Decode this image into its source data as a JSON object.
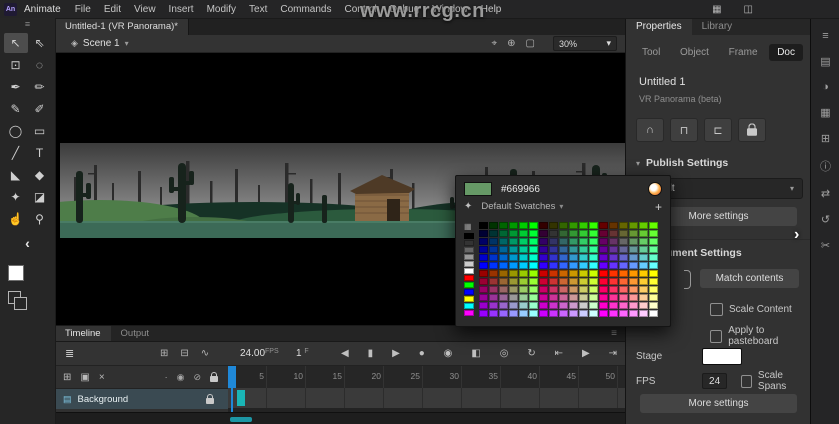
{
  "watermark": "www.rrcg.cn",
  "menubar": {
    "logo_text": "An",
    "app_name": "Animate",
    "items": [
      "File",
      "Edit",
      "View",
      "Insert",
      "Modify",
      "Text",
      "Commands",
      "Control",
      "Debug",
      "Window",
      "Help"
    ],
    "right_icons": [
      {
        "name": "workspace-icon",
        "glyph": "▦"
      },
      {
        "name": "panels-icon",
        "glyph": "◫"
      }
    ]
  },
  "toolbar": {
    "menu_icon": "≡",
    "tools": [
      {
        "name": "selection-tool",
        "glyph": "↖",
        "selected": true
      },
      {
        "name": "subselection-tool",
        "glyph": "⇖"
      },
      {
        "name": "free-transform-tool",
        "glyph": "⊡"
      },
      {
        "name": "lasso-tool",
        "glyph": "◌"
      },
      {
        "name": "pen-tool",
        "glyph": "✒"
      },
      {
        "name": "pencil-tool",
        "glyph": "✏"
      },
      {
        "name": "classic-brush-tool",
        "glyph": "✎"
      },
      {
        "name": "paint-brush-tool",
        "glyph": "✐"
      },
      {
        "name": "oval-tool",
        "glyph": "◯"
      },
      {
        "name": "rectangle-tool",
        "glyph": "▭"
      },
      {
        "name": "line-tool",
        "glyph": "╱"
      },
      {
        "name": "text-tool",
        "glyph": "T"
      },
      {
        "name": "paint-bucket-tool",
        "glyph": "◣"
      },
      {
        "name": "ink-bottle-tool",
        "glyph": "◆"
      },
      {
        "name": "eyedropper-tool",
        "glyph": "✦"
      },
      {
        "name": "eraser-tool",
        "glyph": "◪"
      },
      {
        "name": "hand-tool",
        "glyph": "☝"
      },
      {
        "name": "zoom-tool",
        "glyph": "⚲"
      }
    ],
    "collapse_icon": "‹"
  },
  "document_tab": {
    "title": "Untitled-1 (VR Panorama)*"
  },
  "edit_bar": {
    "scene_icon": "◈",
    "scene_label": "Scene 1",
    "scene_chevron": "▾",
    "icons": [
      {
        "name": "center-frame-icon",
        "glyph": "⌖"
      },
      {
        "name": "zoom-fit-icon",
        "glyph": "⊕"
      },
      {
        "name": "clip-content-icon",
        "glyph": "▢"
      }
    ],
    "zoom_value": "30%",
    "zoom_chevron": "▾"
  },
  "color_picker": {
    "hex": "#669966",
    "swatch_color": "#669966",
    "eyedropper_icon": "✦",
    "dropdown_label": "Default Swatches",
    "dropdown_chevron": "▾",
    "add_label": "+",
    "grid_icon": "▦",
    "palette": {
      "steps": [
        "00",
        "33",
        "66",
        "99",
        "CC",
        "FF"
      ],
      "left_column": [
        "#000000",
        "#333333",
        "#666666",
        "#999999",
        "#CCCCCC",
        "#FFFFFF",
        "#FF0000",
        "#00FF00",
        "#0000FF",
        "#FFFF00",
        "#00FFFF",
        "#FF00FF"
      ],
      "rows": 12,
      "cols": 18
    }
  },
  "properties": {
    "tabs": [
      {
        "label": "Properties",
        "active": true
      },
      {
        "label": "Library"
      }
    ],
    "subtabs": [
      {
        "label": "Tool"
      },
      {
        "label": "Object"
      },
      {
        "label": "Frame"
      },
      {
        "label": "Doc",
        "active": true
      }
    ],
    "doc_name": "Untitled 1",
    "doc_subtitle": "VR Panorama (beta)",
    "toggle_icons": [
      {
        "name": "snap-align-icon",
        "glyph": "∩"
      },
      {
        "name": "snap-grid-icon",
        "glyph": "⊓"
      },
      {
        "name": "snap-guides-icon",
        "glyph": "⊏"
      }
    ],
    "publish_header": "Publish Settings",
    "chevron_down": "▾",
    "publish_preset": "Default",
    "more_settings_label": "More settings",
    "doc_settings_header": "Document Settings",
    "match_contents_label": "Match contents",
    "scale_content_label": "Scale Content",
    "apply_pasteboard_label": "Apply to pasteboard",
    "stage_label": "Stage",
    "fps_label": "FPS",
    "fps_value": "24",
    "scale_spans_label": "Scale Spans",
    "more_settings2_label": "More settings",
    "expand_chevron": "›"
  },
  "timeline": {
    "tabs": [
      {
        "label": "Timeline",
        "active": true
      },
      {
        "label": "Output"
      }
    ],
    "menu_icon": "≡",
    "layers_panel_icon": "≣",
    "mid_icons": [
      {
        "name": "insert-frame-icon",
        "glyph": "⊞"
      },
      {
        "name": "remove-frame-icon",
        "glyph": "⊟"
      },
      {
        "name": "graph-editor-icon",
        "glyph": "∿"
      }
    ],
    "fps_value": "24.00",
    "fps_suffix": "FPS",
    "frame_value": "1",
    "frame_suffix": "F",
    "play_icons": [
      {
        "name": "step-back-icon",
        "glyph": "◀"
      },
      {
        "name": "stop-icon",
        "glyph": "▮"
      },
      {
        "name": "step-forward-icon",
        "glyph": "▶"
      },
      {
        "name": "record-icon",
        "glyph": "●"
      },
      {
        "name": "onion-skin-icon",
        "glyph": "◉"
      },
      {
        "name": "edit-multiple-frames-icon",
        "glyph": "◧"
      },
      {
        "name": "camera-icon",
        "glyph": "◎"
      },
      {
        "name": "loop-icon",
        "glyph": "↻"
      },
      {
        "name": "prev-keyframe-icon",
        "glyph": "⇤"
      },
      {
        "name": "play-icon",
        "glyph": "▶"
      },
      {
        "name": "next-keyframe-icon",
        "glyph": "⇥"
      }
    ],
    "layer_controls": [
      {
        "name": "new-layer-icon",
        "glyph": "⊞"
      },
      {
        "name": "new-folder-icon",
        "glyph": "▣"
      },
      {
        "name": "delete-layer-icon",
        "glyph": "×"
      }
    ],
    "column_icons": [
      {
        "name": "highlight-column-icon",
        "glyph": "·"
      },
      {
        "name": "visibility-column-icon",
        "glyph": "◉"
      },
      {
        "name": "outline-column-icon",
        "glyph": "⊘"
      }
    ],
    "layer": {
      "icon": "▤",
      "name": "Background"
    },
    "ruler": [
      5,
      10,
      15,
      20,
      25,
      30,
      35,
      40,
      45,
      50
    ]
  },
  "right_strip": {
    "top_icon": {
      "name": "collapse-panels-icon",
      "glyph": "◫"
    },
    "icons": [
      {
        "name": "properties-strip-icon",
        "glyph": "≡"
      },
      {
        "name": "library-strip-icon",
        "glyph": "▤"
      },
      {
        "name": "color-strip-icon",
        "glyph": "◑"
      },
      {
        "name": "swatches-strip-icon",
        "glyph": "▦"
      },
      {
        "name": "align-strip-icon",
        "glyph": "⊞"
      },
      {
        "name": "info-strip-icon",
        "glyph": "ⓘ"
      },
      {
        "name": "transform-strip-icon",
        "glyph": "⇄"
      },
      {
        "name": "history-strip-icon",
        "glyph": "↺"
      },
      {
        "name": "scissors-strip-icon",
        "glyph": "✂"
      }
    ]
  },
  "colors": {
    "accent_blue": "#1f88d8",
    "keyframe_teal": "#1ab5b5",
    "selected_swatch": "#669966"
  }
}
